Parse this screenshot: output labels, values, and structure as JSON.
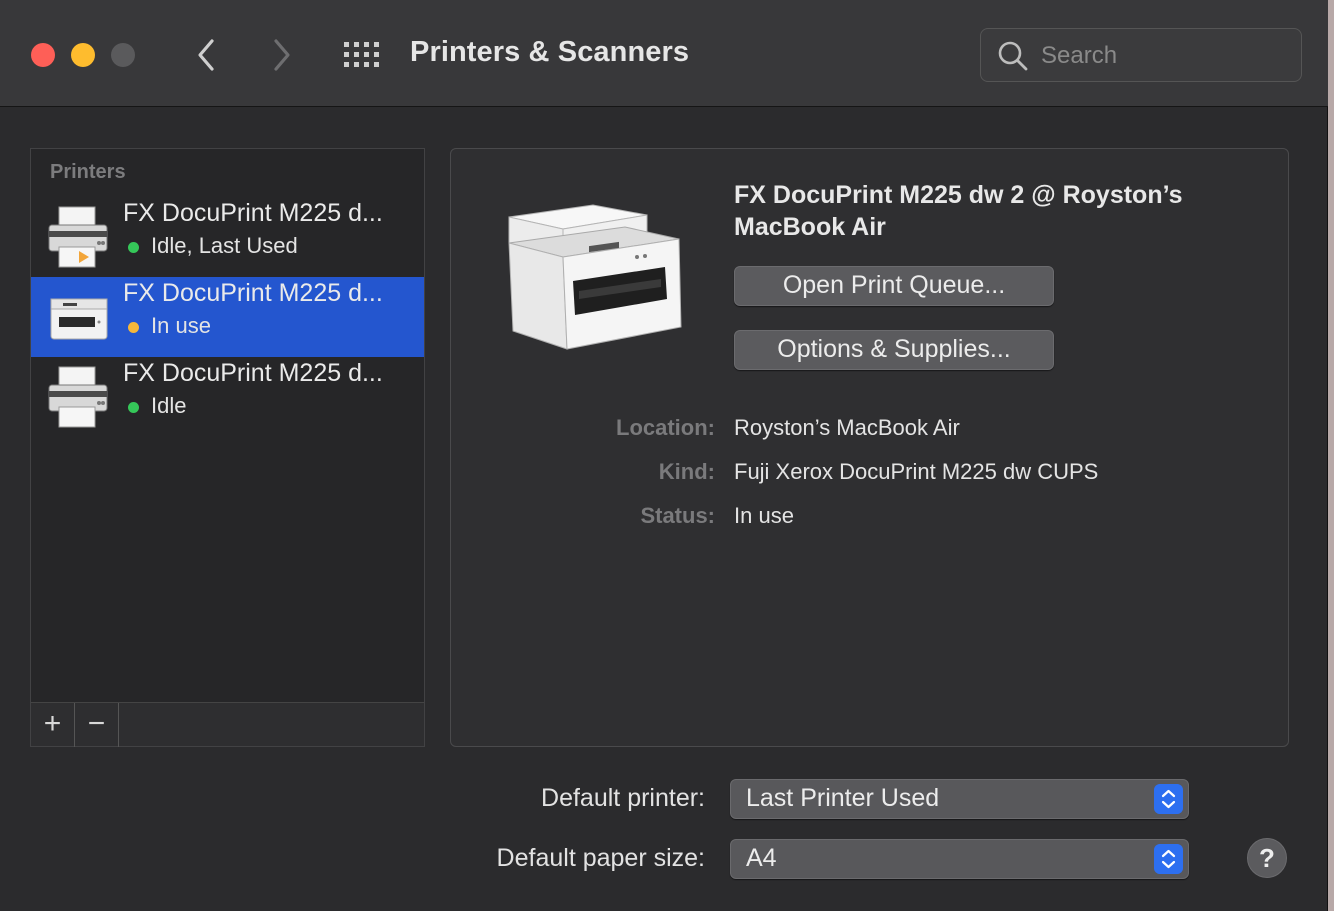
{
  "window": {
    "title": "Printers & Scanners",
    "search_placeholder": "Search"
  },
  "printers": {
    "header": "Printers",
    "items": [
      {
        "name": "FX DocuPrint M225 d...",
        "status": "Idle, Last Used",
        "status_color": "#35c759",
        "selected": false
      },
      {
        "name": "FX DocuPrint M225 d...",
        "status": "In use",
        "status_color": "#f5b73b",
        "selected": true
      },
      {
        "name": "FX DocuPrint M225 d...",
        "status": "Idle",
        "status_color": "#35c759",
        "selected": false
      }
    ],
    "add_label": "+",
    "remove_label": "−"
  },
  "detail": {
    "printer_name": "FX DocuPrint M225 dw 2 @ Royston’s MacBook Air",
    "open_queue_label": "Open Print Queue...",
    "options_label": "Options & Supplies...",
    "location_label": "Location:",
    "location_value": "Royston’s MacBook Air",
    "kind_label": "Kind:",
    "kind_value": "Fuji Xerox DocuPrint M225 dw CUPS",
    "status_label": "Status:",
    "status_value": "In use"
  },
  "defaults": {
    "printer_label": "Default printer:",
    "printer_value": "Last Printer Used",
    "paper_label": "Default paper size:",
    "paper_value": "A4"
  },
  "help_label": "?",
  "colors": {
    "accent": "#2456cf",
    "stepper": "#2d6ff0"
  }
}
